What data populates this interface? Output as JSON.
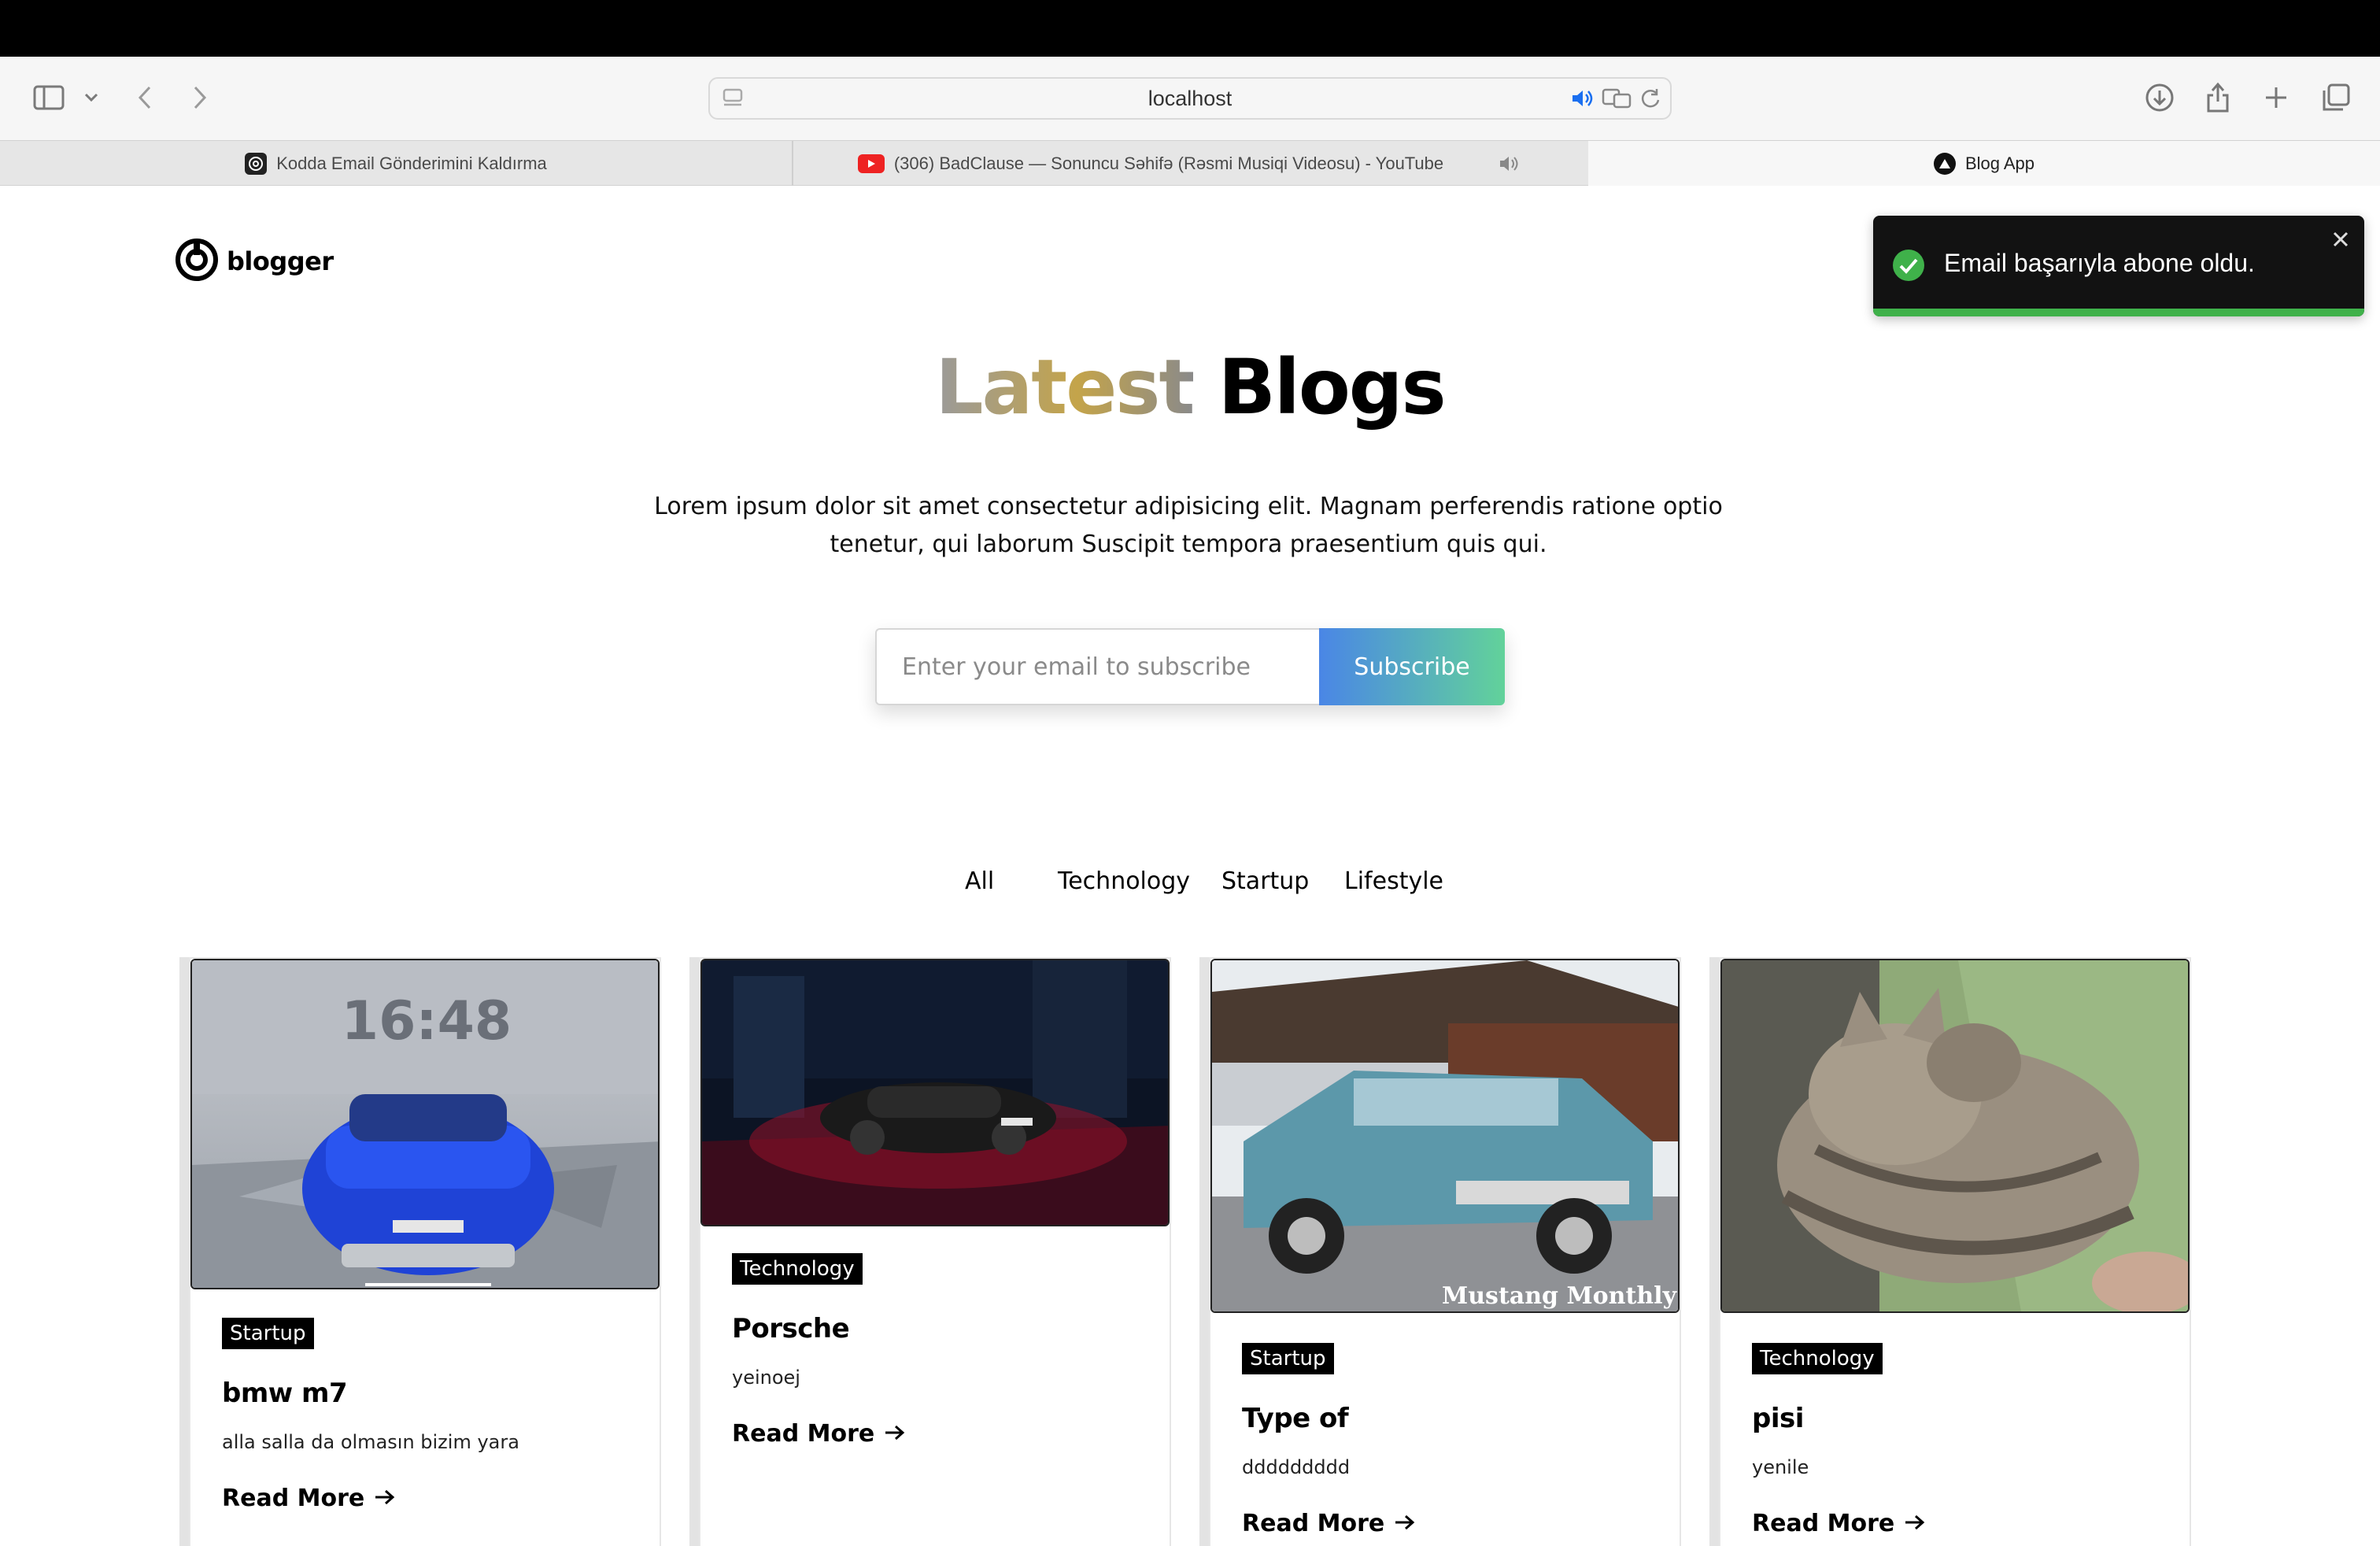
{
  "browser": {
    "address": "localhost",
    "tabs": [
      {
        "label": "Kodda Email Gönderimini Kaldırma"
      },
      {
        "label": "(306) BadClause — Sonuncu Səhifə (Rəsmi Musiqi Videosu) - YouTube"
      },
      {
        "label": "Blog App"
      }
    ]
  },
  "site": {
    "logo_text": "blogger"
  },
  "toast": {
    "message": "Email başarıyla abone oldu.",
    "status_color": "#3fb14a"
  },
  "hero": {
    "title_highlight": "Latest",
    "title_rest": "Blogs",
    "description": "Lorem ipsum dolor sit amet consectetur adipisicing elit. Magnam perferendis ratione optio tenetur, qui laborum Suscipit tempora praesentium quis qui."
  },
  "subscribe": {
    "placeholder": "Enter your email to subscribe",
    "button_label": "Subscribe"
  },
  "filters": [
    {
      "label": "All"
    },
    {
      "label": "Technology"
    },
    {
      "label": "Startup"
    },
    {
      "label": "Lifestyle"
    }
  ],
  "cards": [
    {
      "category": "Startup",
      "title": "bmw m7",
      "description": "alla salla da olmasın bizim yara",
      "read_more": "Read More",
      "image": "blue-bmw-car",
      "image_text": "16:48"
    },
    {
      "category": "Technology",
      "title": "Porsche",
      "description": "yeinoej",
      "read_more": "Read More",
      "image": "porsche-night"
    },
    {
      "category": "Startup",
      "title": "Type of",
      "description": "ddddddddd",
      "read_more": "Read More",
      "image": "mustang-car",
      "image_text": "Mustang Monthly"
    },
    {
      "category": "Technology",
      "title": "pisi",
      "description": "yenile",
      "read_more": "Read More",
      "image": "cat-photo"
    }
  ]
}
